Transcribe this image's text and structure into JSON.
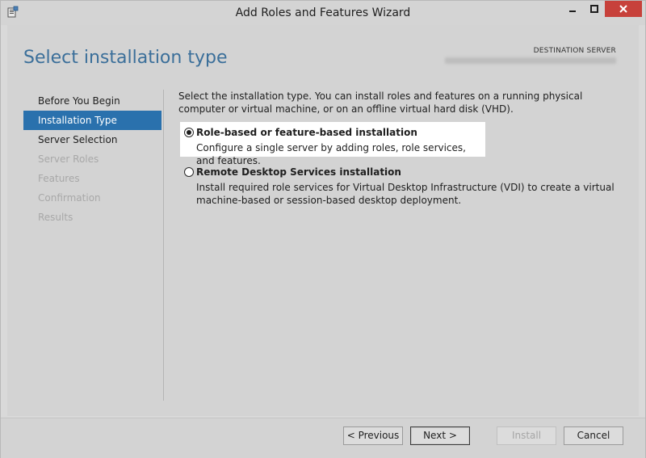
{
  "window": {
    "title": "Add Roles and Features Wizard"
  },
  "page": {
    "title": "Select installation type",
    "destination_label": "DESTINATION SERVER"
  },
  "nav": {
    "items": [
      {
        "label": "Before You Begin",
        "state": "normal"
      },
      {
        "label": "Installation Type",
        "state": "active"
      },
      {
        "label": "Server Selection",
        "state": "normal"
      },
      {
        "label": "Server Roles",
        "state": "disabled"
      },
      {
        "label": "Features",
        "state": "disabled"
      },
      {
        "label": "Confirmation",
        "state": "disabled"
      },
      {
        "label": "Results",
        "state": "disabled"
      }
    ]
  },
  "main": {
    "intro": "Select the installation type. You can install roles and features on a running physical computer or virtual machine, or on an offline virtual hard disk (VHD).",
    "options": [
      {
        "title": "Role-based or feature-based installation",
        "description": "Configure a single server by adding roles, role services, and features.",
        "selected": true
      },
      {
        "title": "Remote Desktop Services installation",
        "description": "Install required role services for Virtual Desktop Infrastructure (VDI) to create a virtual machine-based or session-based desktop deployment.",
        "selected": false
      }
    ]
  },
  "footer": {
    "previous_label": "< Previous",
    "next_label": "Next >",
    "install_label": "Install",
    "cancel_label": "Cancel"
  },
  "colors": {
    "accent": "#2a71ad",
    "title_blue": "#3b6f9a",
    "close_red": "#c7413b",
    "disabled_text": "#a8a8a8"
  }
}
